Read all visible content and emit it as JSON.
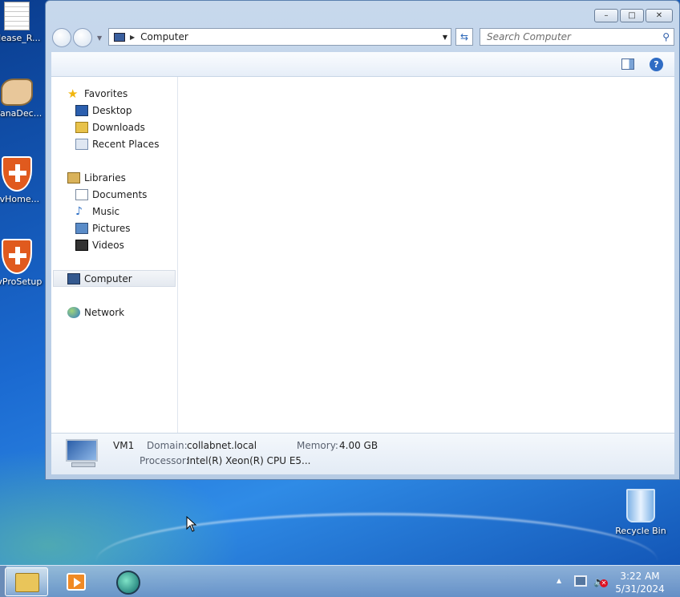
{
  "desktop": {
    "icons": [
      {
        "label": "Please_R..."
      },
      {
        "label": "WanaDec..."
      },
      {
        "label": "avHome..."
      },
      {
        "label": "avProSetup"
      },
      {
        "label": "Recycle Bin"
      }
    ]
  },
  "window": {
    "caption_buttons": {
      "minimize": "–",
      "maximize": "□",
      "close": "✕"
    },
    "address": {
      "location": "Computer"
    },
    "search": {
      "placeholder": "Search Computer"
    },
    "help_glyph": "?",
    "nav_pane": {
      "favorites": {
        "header": "Favorites",
        "items": [
          "Desktop",
          "Downloads",
          "Recent Places"
        ]
      },
      "libraries": {
        "header": "Libraries",
        "items": [
          "Documents",
          "Music",
          "Pictures",
          "Videos"
        ]
      },
      "computer": "Computer",
      "network": "Network"
    },
    "details": {
      "name": "VM1",
      "domain_label": "Domain:",
      "domain_value": "collabnet.local",
      "memory_label": "Memory:",
      "memory_value": "4.00 GB",
      "processor_label": "Processor:",
      "processor_value": "Intel(R) Xeon(R) CPU E5..."
    }
  },
  "taskbar": {
    "clock": {
      "time": "3:22 AM",
      "date": "5/31/2024"
    }
  }
}
